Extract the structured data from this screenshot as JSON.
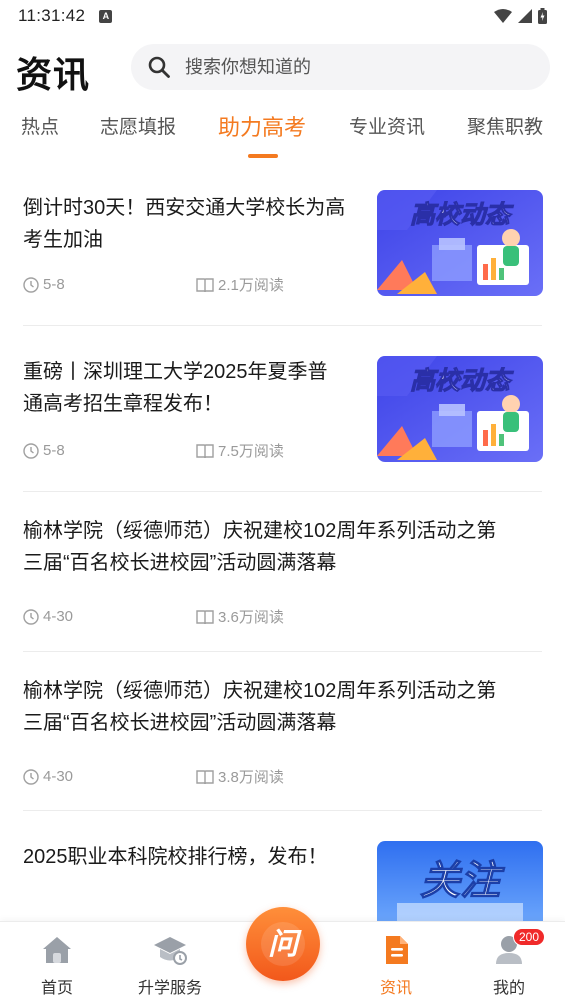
{
  "status_bar": {
    "time": "11:31:42",
    "notification_letter": "A"
  },
  "header": {
    "title": "资讯",
    "search_placeholder": "搜索你想知道的"
  },
  "tabs": [
    {
      "label": "热点"
    },
    {
      "label": "志愿填报"
    },
    {
      "label": "助力高考",
      "active": true
    },
    {
      "label": "专业资讯"
    },
    {
      "label": "聚焦职教"
    }
  ],
  "articles": [
    {
      "title_line1": "倒计时30天！西安交通大学校长为高",
      "title_line2": "考生加油",
      "date": "5-8",
      "views": "2.1万阅读",
      "thumb_text": "高校动态"
    },
    {
      "title_line1": "重磅丨深圳理工大学2025年夏季普",
      "title_line2": "通高考招生章程发布！",
      "date": "5-8",
      "views": "7.5万阅读",
      "thumb_text": "高校动态"
    },
    {
      "title_line1": "榆林学院（绥德师范）庆祝建校102周年系列活动之第",
      "title_line2": "三届“百名校长进校园”活动圆满落幕",
      "date": "4-30",
      "views": "3.6万阅读"
    },
    {
      "title_line1": "榆林学院（绥德师范）庆祝建校102周年系列活动之第",
      "title_line2": "三届“百名校长进校园”活动圆满落幕",
      "date": "4-30",
      "views": "3.8万阅读"
    },
    {
      "title_line1": "2025职业本科院校排行榜，发布！",
      "thumb_text": "关注"
    }
  ],
  "bottom_nav": {
    "home": "首页",
    "services": "升学服务",
    "center_glyph": "问",
    "news": "资讯",
    "mine": "我的",
    "mine_badge": "200"
  },
  "colors": {
    "accent": "#f47a20",
    "thumb_blue": "#4b4ff0",
    "badge_red": "#f02a2a"
  }
}
